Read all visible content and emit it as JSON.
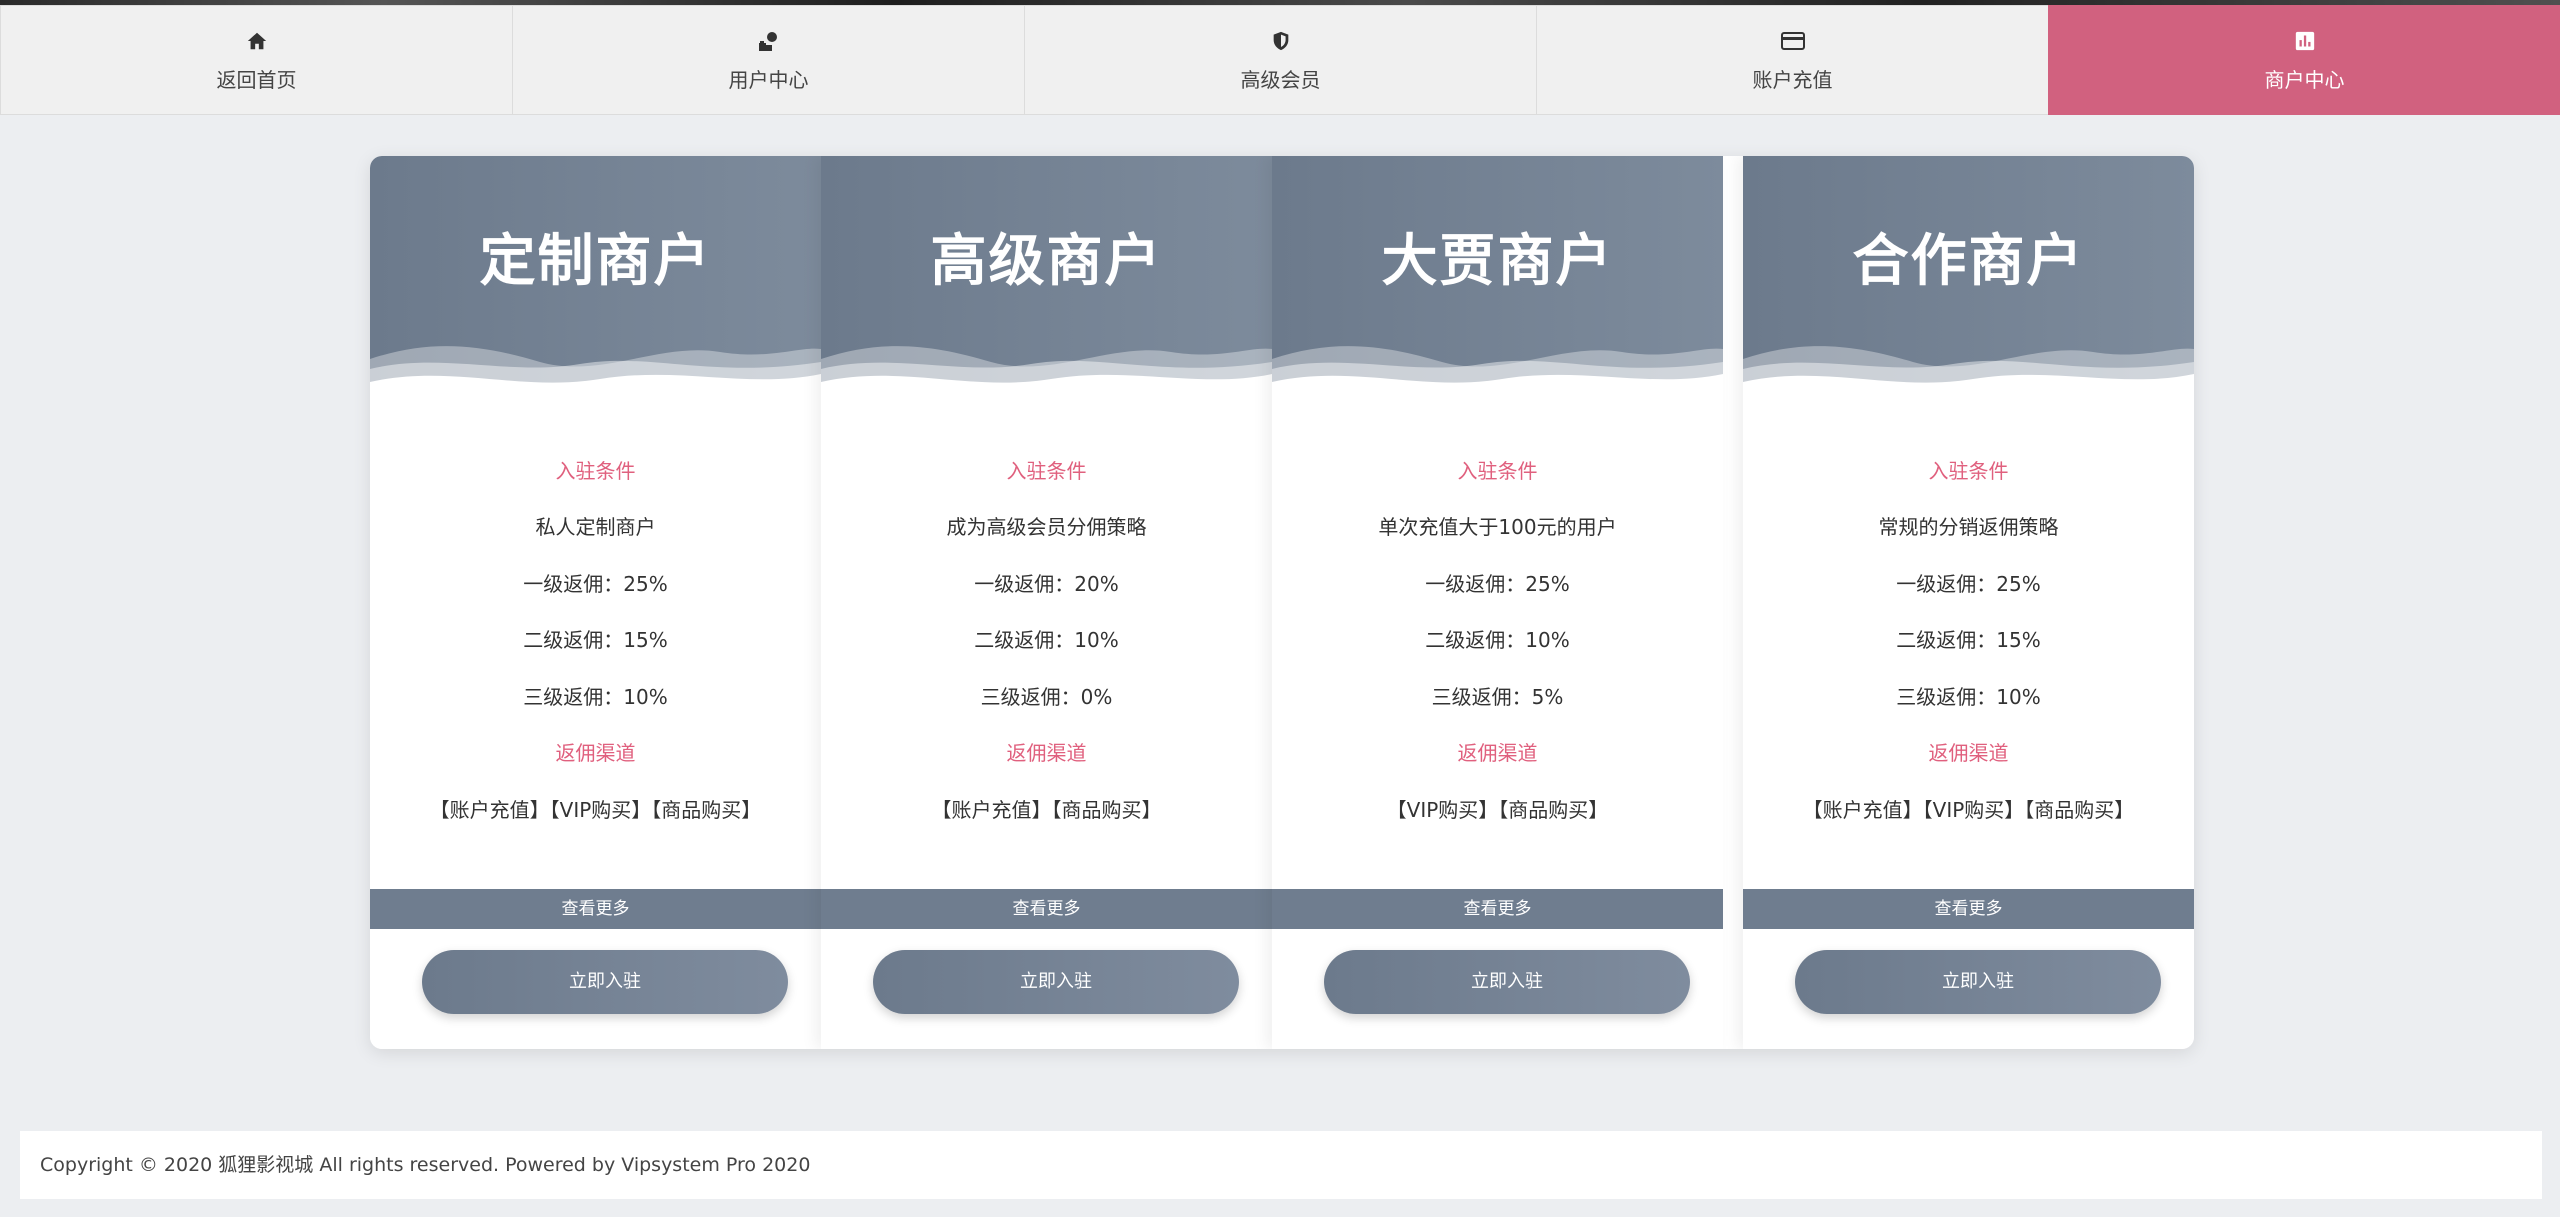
{
  "colors": {
    "accent": "#d1617f",
    "card_header": "#75839a",
    "label_accent": "#e0607e",
    "page_bg": "#eceef1"
  },
  "nav": {
    "items": [
      {
        "label": "返回首页",
        "icon": "home-icon",
        "active": false
      },
      {
        "label": "用户中心",
        "icon": "user-center-icon",
        "active": false
      },
      {
        "label": "高级会员",
        "icon": "shield-icon",
        "active": false
      },
      {
        "label": "账户充值",
        "icon": "credit-card-icon",
        "active": false
      },
      {
        "label": "商户中心",
        "icon": "chart-icon",
        "active": true
      }
    ]
  },
  "cards": [
    {
      "title": "定制商户",
      "condition_label": "入驻条件",
      "condition": "私人定制商户",
      "level1": "一级返佣：25%",
      "level2": "二级返佣：15%",
      "level3": "三级返佣：10%",
      "channel_label": "返佣渠道",
      "channels": "【账户充值】【VIP购买】【商品购买】",
      "more": "查看更多",
      "join": "立即入驻"
    },
    {
      "title": "高级商户",
      "condition_label": "入驻条件",
      "condition": "成为高级会员分佣策略",
      "level1": "一级返佣：20%",
      "level2": "二级返佣：10%",
      "level3": "三级返佣：0%",
      "channel_label": "返佣渠道",
      "channels": "【账户充值】【商品购买】",
      "more": "查看更多",
      "join": "立即入驻"
    },
    {
      "title": "大贾商户",
      "condition_label": "入驻条件",
      "condition": "单次充值大于100元的用户",
      "level1": "一级返佣：25%",
      "level2": "二级返佣：10%",
      "level3": "三级返佣：5%",
      "channel_label": "返佣渠道",
      "channels": "【VIP购买】【商品购买】",
      "more": "查看更多",
      "join": "立即入驻"
    },
    {
      "title": "合作商户",
      "condition_label": "入驻条件",
      "condition": "常规的分销返佣策略",
      "level1": "一级返佣：25%",
      "level2": "二级返佣：15%",
      "level3": "三级返佣：10%",
      "channel_label": "返佣渠道",
      "channels": "【账户充值】【VIP购买】【商品购买】",
      "more": "查看更多",
      "join": "立即入驻"
    }
  ],
  "footer": {
    "text": "Copyright © 2020 狐狸影视城 All rights reserved. Powered by Vipsystem Pro 2020"
  }
}
